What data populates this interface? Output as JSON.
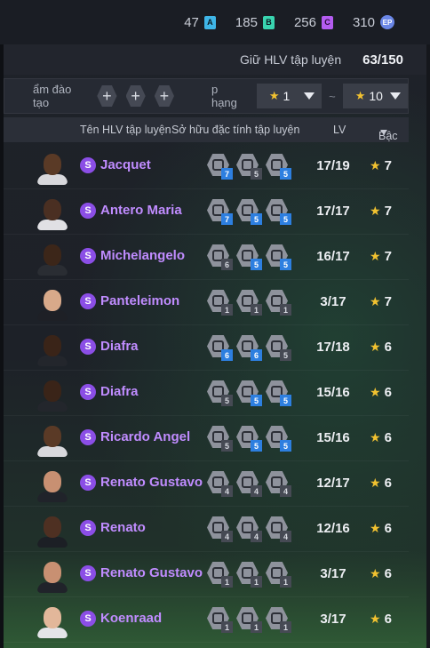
{
  "currencies": [
    {
      "value": "47",
      "icon": "currency-a-icon",
      "glyph": "A",
      "color": "#3fb6e8"
    },
    {
      "value": "185",
      "icon": "currency-b-icon",
      "glyph": "B",
      "color": "#39d4b0"
    },
    {
      "value": "256",
      "icon": "currency-c-icon",
      "glyph": "C",
      "color": "#b45cf0"
    },
    {
      "value": "310",
      "icon": "ep-coin-icon",
      "glyph": "EP",
      "color": "#6a86e6"
    }
  ],
  "keep": {
    "label": "Giữ HLV tập luyện",
    "count": "63/150"
  },
  "filter": {
    "training_label": "ẩm đào tạo",
    "plus": "+",
    "rank_label": "p hạng",
    "rank_from": "1",
    "rank_to": "10",
    "tilde": "~",
    "star": "★"
  },
  "header": {
    "name": "Tên HLV tập luyện",
    "skills": "Sở hữu đặc tính tập luyện",
    "lv": "LV",
    "rank": "Bậc"
  },
  "coaches": [
    {
      "name": "Jacquet",
      "lv": "17/19",
      "rank": "7",
      "skin": "#5a3a26",
      "shirt": "#d8d8dc",
      "skills": [
        "7",
        "5",
        "5"
      ],
      "hi": [
        true,
        false,
        true
      ]
    },
    {
      "name": "Antero Maria",
      "lv": "17/17",
      "rank": "7",
      "skin": "#4a2f22",
      "shirt": "#e0e0e4",
      "skills": [
        "7",
        "5",
        "5"
      ],
      "hi": [
        true,
        true,
        true
      ]
    },
    {
      "name": "Michelangelo",
      "lv": "16/17",
      "rank": "7",
      "skin": "#3c2619",
      "shirt": "#2a2d33",
      "skills": [
        "6",
        "5",
        "5"
      ],
      "hi": [
        false,
        true,
        true
      ]
    },
    {
      "name": "Panteleimon",
      "lv": "3/17",
      "rank": "7",
      "skin": "#d8a98a",
      "shirt": "#1e2026",
      "skills": [
        "1",
        "1",
        "1"
      ],
      "hi": [
        false,
        false,
        false
      ]
    },
    {
      "name": "Diafra",
      "lv": "17/18",
      "rank": "6",
      "skin": "#3a2418",
      "shirt": "#23262c",
      "skills": [
        "6",
        "6",
        "5"
      ],
      "hi": [
        true,
        true,
        false
      ]
    },
    {
      "name": "Diafra",
      "lv": "15/16",
      "rank": "6",
      "skin": "#3a2418",
      "shirt": "#23262c",
      "skills": [
        "5",
        "5",
        "5"
      ],
      "hi": [
        false,
        true,
        true
      ]
    },
    {
      "name": "Ricardo Angel",
      "lv": "15/16",
      "rank": "6",
      "skin": "#5a3a26",
      "shirt": "#d8d8dc",
      "skills": [
        "5",
        "5",
        "5"
      ],
      "hi": [
        false,
        true,
        true
      ]
    },
    {
      "name": "Renato Gustavo",
      "lv": "12/17",
      "rank": "6",
      "skin": "#c89072",
      "shirt": "#20232a",
      "skills": [
        "4",
        "4",
        "4"
      ],
      "hi": [
        false,
        false,
        false
      ]
    },
    {
      "name": "Renato",
      "lv": "12/16",
      "rank": "6",
      "skin": "#4e3022",
      "shirt": "#1c1f25",
      "skills": [
        "4",
        "4",
        "4"
      ],
      "hi": [
        false,
        false,
        false
      ]
    },
    {
      "name": "Renato Gustavo",
      "lv": "3/17",
      "rank": "6",
      "skin": "#c89072",
      "shirt": "#20232a",
      "skills": [
        "1",
        "1",
        "1"
      ],
      "hi": [
        false,
        false,
        false
      ]
    },
    {
      "name": "Koenraad",
      "lv": "3/17",
      "rank": "6",
      "skin": "#e2b79a",
      "shirt": "#e4e4e8",
      "skills": [
        "1",
        "1",
        "1"
      ],
      "hi": [
        false,
        false,
        false
      ]
    }
  ]
}
